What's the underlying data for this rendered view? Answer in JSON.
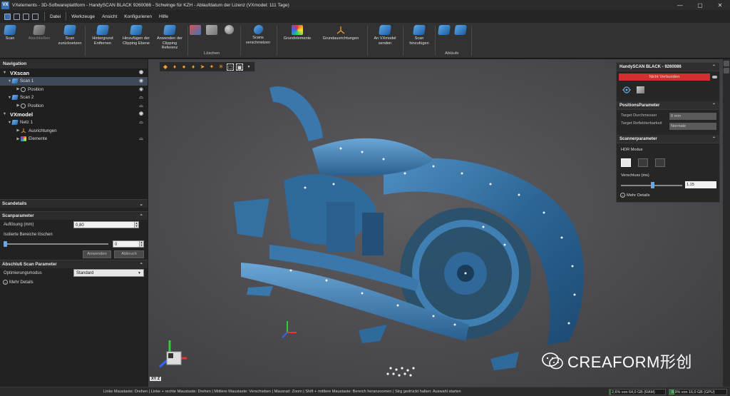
{
  "window": {
    "title": "VXelements - 3D-Softwareplattform - HandySCAN BLACK 9260086 - Schwinge für KZH - Ablaufdatum der Lizenz (VXmodel: 111 Tage)",
    "logo": "VX"
  },
  "menu": [
    "Datei",
    "Werkzeuge",
    "Ansicht",
    "Konfigurieren",
    "Hilfe"
  ],
  "ribbon": {
    "buttons": [
      {
        "label": "Scan",
        "icon": "scan-icon"
      },
      {
        "label": "Abschließen",
        "icon": "finish-icon"
      },
      {
        "label": "Scan zurücksetzen",
        "icon": "reset-scan-icon"
      },
      {
        "label": "Hintergrund Entfernen",
        "icon": "remove-background-icon"
      },
      {
        "label": "Hinzufügen der Clipping Ebene",
        "icon": "clipping-plane-icon"
      },
      {
        "label": "Anwenden der Clipping Referenz",
        "icon": "clipping-reference-icon"
      },
      {
        "label": "Scans verschmelzen",
        "icon": "merge-icon"
      },
      {
        "label": "Grundelemente",
        "icon": "entities-icon"
      },
      {
        "label": "Grundausrichtungen",
        "icon": "alignment-icon"
      },
      {
        "label": "An VXmodel senden",
        "icon": "send-icon"
      },
      {
        "label": "Scan hinzufügen",
        "icon": "add-scan-icon"
      }
    ],
    "groups": {
      "delete": "Löschen",
      "workflows": "Abläufe"
    }
  },
  "navigation": {
    "title": "Navigation",
    "tree": [
      {
        "label": "VXscan"
      },
      {
        "label": "Scan 1"
      },
      {
        "label": "Position"
      },
      {
        "label": "Scan 2"
      },
      {
        "label": "Position"
      },
      {
        "label": "VXmodel"
      },
      {
        "label": "Netz 1"
      },
      {
        "label": "Ausrichtungen"
      },
      {
        "label": "Elemente"
      }
    ]
  },
  "scan_details": {
    "title": "Scandetails",
    "params_title": "Scanparameter",
    "resolution_label": "Auflösung (mm)",
    "resolution_value": "0,80",
    "isolated_label": "Isolierte Bereiche löschen",
    "isolated_value": "0",
    "apply_label": "Anwenden",
    "cancel_label": "Abbruch",
    "final_title": "Abschluß Scan Parameter",
    "optimization_label": "Optimierungsmodus",
    "optimization_value": "Standard",
    "more_label": "Mehr Details"
  },
  "scanner_panel": {
    "title": "HandySCAN BLACK - 9260086",
    "connect_label": "Nicht Verbunden",
    "position_title": "PositionsParameter",
    "target_diameter_label": "Target Durchmesser",
    "target_diameter_value": "6 mm",
    "target_reflect_label": "Target Reflektierbarkeit",
    "target_reflect_value": "Normale",
    "scanner_title": "Scannerparameter",
    "hdr_label": "HDR Modus",
    "shutter_label": "Verschluss (ms)",
    "shutter_value": "1,15",
    "more_label": "Mehr Details"
  },
  "viewport": {
    "axis_label": "XY Z"
  },
  "status": {
    "hint": "Linke Maustaste: Drehen  |  Linke + rechte Maustaste: Drehen  |  Mittlere Maustaste: Verschieben  |  Mausrad: Zoom  |  Shift + mittlere Maustaste: Bereich heranzoomen  |  Strg gedrückt halten: Auswahl starten",
    "ram_text": "2,6% von 64,0 GB (RAM)",
    "ram_fraction": 0.026,
    "gpu_text": "8,9% von 16,0 GB (GPU)",
    "gpu_fraction": 0.089
  },
  "watermark": {
    "text": "CREAFORM形创"
  }
}
